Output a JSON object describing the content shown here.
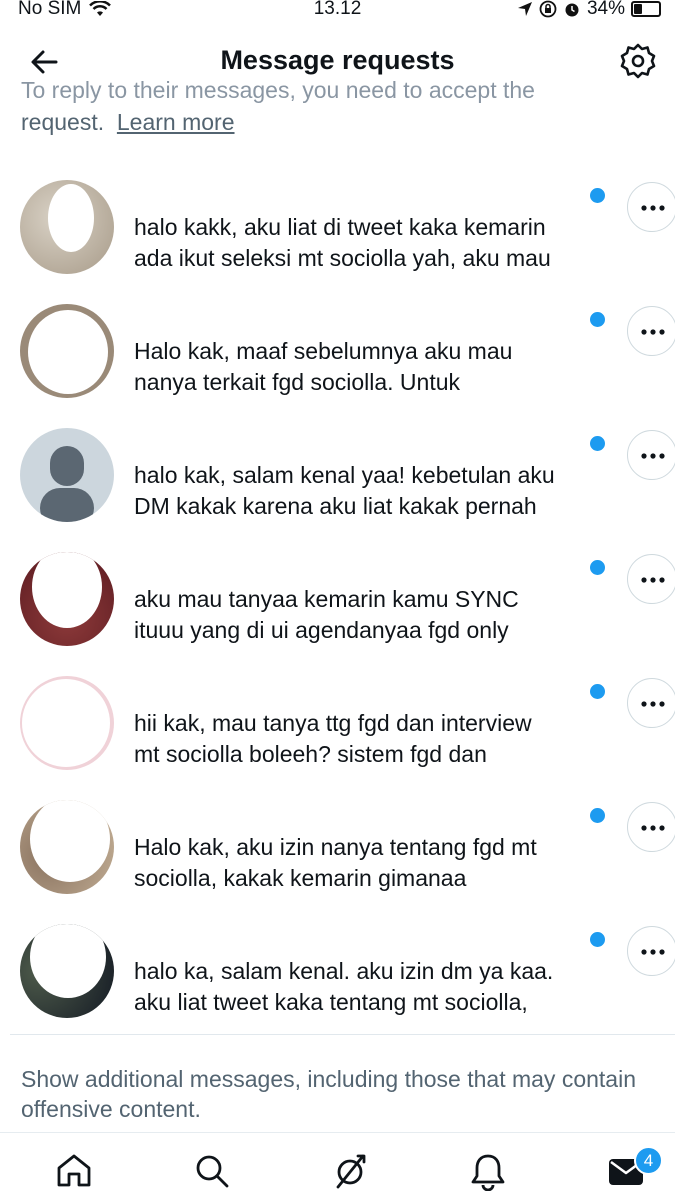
{
  "status_bar": {
    "carrier": "No SIM",
    "time": "13.12",
    "battery": "34%"
  },
  "header": {
    "title": "Message requests"
  },
  "intro": {
    "text_cut": "To reply to their messages, you need to accept the",
    "text": "request.",
    "learn_more": "Learn more"
  },
  "requests": [
    {
      "line1": "halo kakk, aku liat di tweet kaka kemarin",
      "line2": "ada ikut seleksi mt sociolla yah, aku mau",
      "avatar": "photo-beige"
    },
    {
      "line1": "Halo kak, maaf sebelumnya aku mau",
      "line2": "nanya terkait fgd sociolla. Untuk",
      "avatar": "photo-brown"
    },
    {
      "line1": "halo kak, salam kenal yaa! kebetulan aku",
      "line2": "DM kakak karena aku liat kakak pernah",
      "avatar": "default-avatar"
    },
    {
      "line1": "aku mau tanyaa kemarin kamu SYNC",
      "line2": "ituuu yang di ui agendanyaa fgd only",
      "avatar": "photo-maroon"
    },
    {
      "line1": "hii kak, mau tanya ttg fgd dan interview",
      "line2": "mt sociolla boleeh? sistem fgd dan",
      "avatar": "photo-pink"
    },
    {
      "line1": "Halo kak, aku izin nanya tentang fgd mt",
      "line2": "sociolla, kakak kemarin gimanaa",
      "avatar": "photo-tan"
    },
    {
      "line1": "halo ka, salam kenal. aku izin dm ya kaa.",
      "line2": "aku liat tweet kaka tentang mt sociolla,",
      "avatar": "photo-dark"
    }
  ],
  "additional_messages": "Show additional messages, including those that may contain offensive content.",
  "tab_bar": {
    "messages_badge": "4",
    "icons": [
      "home-icon",
      "search-icon",
      "spaces-icon",
      "notifications-icon",
      "messages-icon"
    ]
  },
  "colors": {
    "accent": "#1d9bf0",
    "text": "#0f1419",
    "secondary": "#536471"
  }
}
